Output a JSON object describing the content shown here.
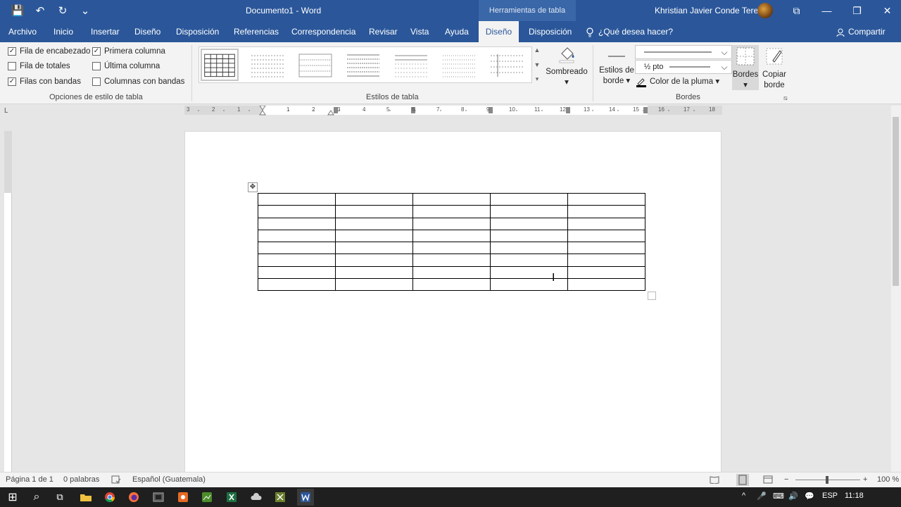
{
  "titlebar": {
    "document_title": "Documento1  -  Word",
    "tools_header": "Herramientas de tabla",
    "user_name": "Khristian Javier Conde Teret",
    "qat": {
      "save": "💾",
      "undo": "↶",
      "redo": "↻",
      "customize": "⌄"
    },
    "window": {
      "ribbon_display": "⧉",
      "minimize": "—",
      "restore": "❐",
      "close": "✕"
    }
  },
  "tabs": [
    {
      "label": "Archivo"
    },
    {
      "label": "Inicio"
    },
    {
      "label": "Insertar"
    },
    {
      "label": "Diseño"
    },
    {
      "label": "Disposición"
    },
    {
      "label": "Referencias"
    },
    {
      "label": "Correspondencia"
    },
    {
      "label": "Revisar"
    },
    {
      "label": "Vista"
    },
    {
      "label": "Ayuda"
    },
    {
      "label": "Diseño"
    },
    {
      "label": "Disposición"
    }
  ],
  "tell_me": "¿Qué desea hacer?",
  "share": "Compartir",
  "ribbon": {
    "options": {
      "group_label": "Opciones de estilo de tabla",
      "header_row": {
        "label": "Fila de encabezado",
        "checked": true,
        "mark": "✓"
      },
      "total_row": {
        "label": "Fila de totales",
        "checked": false,
        "mark": ""
      },
      "banded_rows": {
        "label": "Filas con bandas",
        "checked": true,
        "mark": "✓"
      },
      "first_column": {
        "label": "Primera columna",
        "checked": true,
        "mark": "✓"
      },
      "last_column": {
        "label": "Última columna",
        "checked": false,
        "mark": ""
      },
      "banded_columns": {
        "label": "Columnas con bandas",
        "checked": false,
        "mark": ""
      }
    },
    "styles": {
      "group_label": "Estilos de tabla",
      "shading_label": "Sombreado",
      "shading_arrow": "▾",
      "scroll_up": "▲",
      "scroll_down": "▼",
      "more": "▾"
    },
    "borders": {
      "group_label": "Bordes",
      "border_styles_line1": "Estilos de",
      "border_styles_line2": "borde ▾",
      "line_weight": "½ pto",
      "pen_color": "Color de la pluma ▾",
      "borders_label": "Bordes",
      "borders_arrow": "▾",
      "painter_line1": "Copiar",
      "painter_line2": "borde",
      "dropdown_arrow": "⌵",
      "launcher": "⧅"
    }
  },
  "ruler": {
    "corner": "L",
    "labels": [
      "3",
      "2",
      "1",
      "1",
      "2",
      "3",
      "4",
      "5",
      "6",
      "7",
      "8",
      "9",
      "10",
      "11",
      "12",
      "13",
      "14",
      "15",
      "16",
      "17",
      "18"
    ]
  },
  "document": {
    "table": {
      "rows": 8,
      "cols": 5
    },
    "move_handle": "✥",
    "cursor": "I"
  },
  "status": {
    "page": "Página 1 de 1",
    "words": "0 palabras",
    "language": "Español (Guatemala)",
    "zoom": "100 %",
    "zoom_minus": "−",
    "zoom_plus": "+"
  },
  "taskbar": {
    "lang": "ESP",
    "time": "11:18",
    "start": "⊞",
    "search": "⌕",
    "taskview": "⧉",
    "tray_up": "^",
    "mic": "🎤",
    "network": "⌨",
    "volume": "🔊",
    "notifications": "💬"
  }
}
